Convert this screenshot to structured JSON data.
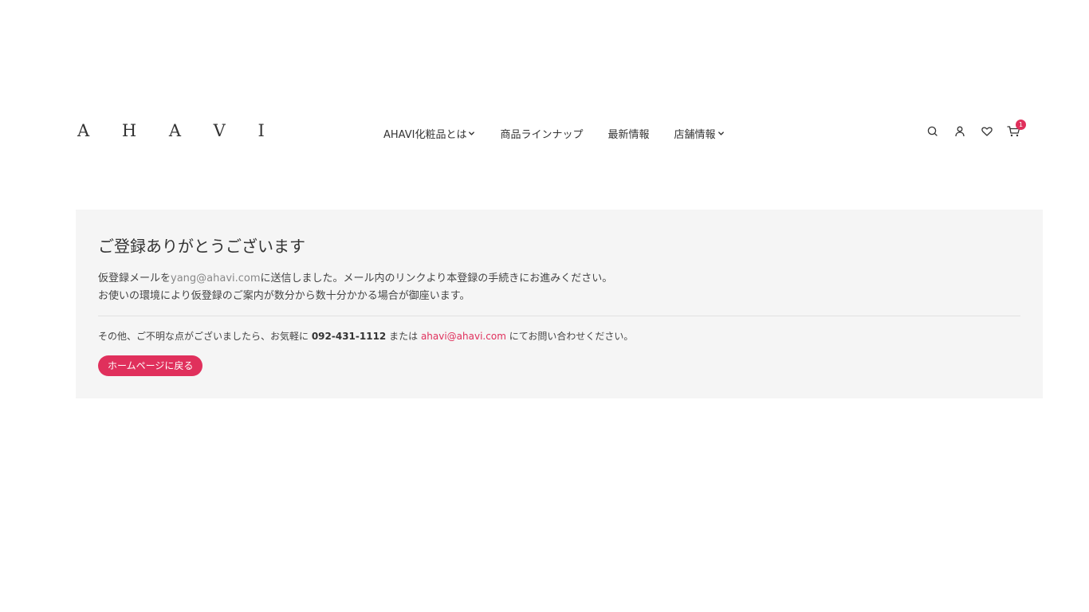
{
  "header": {
    "logo": "A H A V I",
    "nav": [
      {
        "label": "AHAVI化粧品とは",
        "has_dropdown": true
      },
      {
        "label": "商品ラインナップ",
        "has_dropdown": false
      },
      {
        "label": "最新情報",
        "has_dropdown": false
      },
      {
        "label": "店舗情報",
        "has_dropdown": true
      }
    ],
    "icons": [
      "search-icon",
      "user-icon",
      "heart-icon",
      "cart-icon"
    ],
    "cart_count": "1"
  },
  "main": {
    "title": "ご登録ありがとうございます",
    "message_line1_prefix": "仮登録メールを",
    "message_email": "yang@ahavi.com",
    "message_line1_suffix": "に送信しました。メール内のリンクより本登録の手続きにお進みください。",
    "message_line2": "お使いの環境により仮登録のご案内が数分から数十分かかる場合が御座います。",
    "contact_prefix": "その他、ご不明な点がございましたら、お気軽に ",
    "contact_phone": "092-431-1112",
    "contact_middle": " または ",
    "contact_email": "ahavi@ahavi.com",
    "contact_suffix": " にてお問い合わせください。",
    "home_button": "ホームページに戻る"
  },
  "colors": {
    "accent": "#e0305c",
    "panel_bg": "#f5f5f5",
    "text": "#333333"
  }
}
